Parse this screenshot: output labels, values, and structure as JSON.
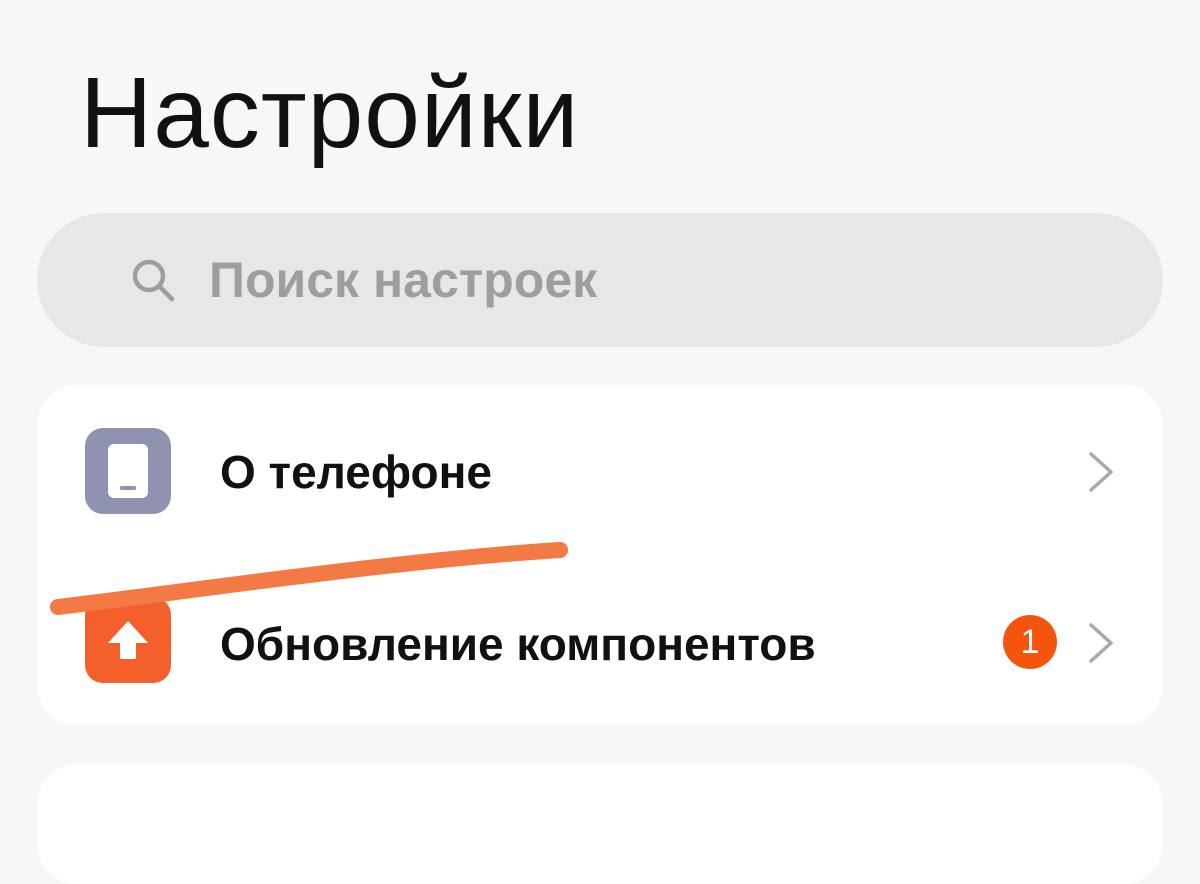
{
  "header": {
    "title": "Настройки"
  },
  "search": {
    "placeholder": "Поиск настроек",
    "icon": "search-icon"
  },
  "settings": {
    "items": [
      {
        "label": "О телефоне",
        "icon": "phone-icon",
        "icon_color": "#8f93b1"
      },
      {
        "label": "Обновление компонентов",
        "icon": "arrow-up-icon",
        "icon_color": "#f4602c",
        "badge": "1",
        "badge_color": "#f4540c"
      }
    ]
  },
  "annotation": {
    "stroke_color": "#f47a45"
  }
}
